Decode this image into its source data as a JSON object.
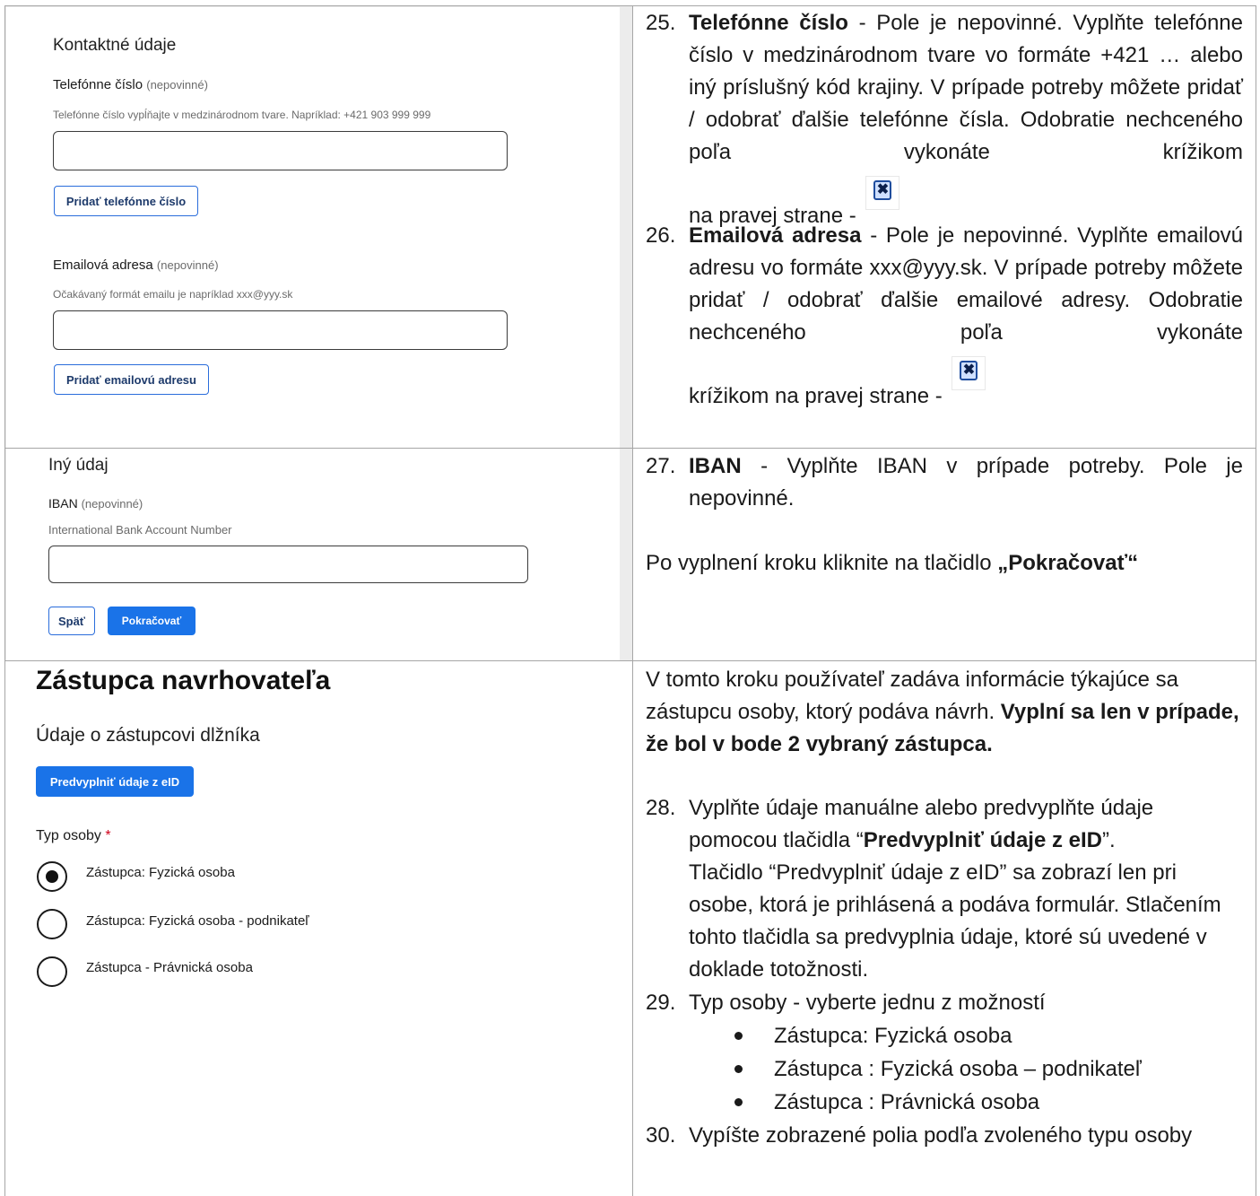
{
  "row1": {
    "form": {
      "section_title": "Kontaktné údaje",
      "phone_label": "Telefónne číslo",
      "phone_optional": "(nepovinné)",
      "phone_hint": "Telefónne číslo vypĺňajte v medzinárodnom tvare. Napríklad: +421 903 999 999",
      "phone_value": "",
      "add_phone_button": "Pridať telefónne číslo",
      "email_label": "Emailová adresa",
      "email_optional": "(nepovinné)",
      "email_hint": "Očakávaný formát emailu je napríklad xxx@yyy.sk",
      "email_value": "",
      "add_email_button": "Pridať emailovú adresu"
    },
    "text": {
      "item25_num": "25.",
      "item25_term": "Telefónne číslo",
      "item25_body": "- Pole je nepovinné. Vyplňte telefónne číslo v medzinárodnom tvare vo formáte +421 … alebo iný príslušný kód krajiny. V prípade potreby môžete pridať / odobrať ďalšie telefónne čísla. Odobratie nechceného poľa vykonáte krížikom",
      "item25_tail": "na pravej strane -",
      "item26_num": "26.",
      "item26_term": "Emailová adresa",
      "item26_body": "- Pole je nepovinné. Vyplňte emailovú adresu vo formáte xxx@yyy.sk. V prípade potreby môžete pridať / odobrať ďalšie emailové adresy. Odobratie nechceného poľa vykonáte",
      "item26_tail": "krížikom na pravej strane -",
      "close_icon_glyph": "✖"
    }
  },
  "row2": {
    "form": {
      "section_title": "Iný údaj",
      "iban_label": "IBAN",
      "iban_optional": "(nepovinné)",
      "iban_hint": "International Bank Account Number",
      "iban_value": "",
      "back_button": "Späť",
      "continue_button": "Pokračovať"
    },
    "text": {
      "item27_num": "27.",
      "item27_term": "IBAN",
      "item27_body": "- Vyplňte IBAN v prípade potreby. Pole je nepovinné.",
      "after_text": "Po vyplnení kroku kliknite na tlačidlo",
      "after_button": "„Pokračovať“"
    }
  },
  "row3": {
    "form": {
      "heading": "Zástupca navrhovateľa",
      "section_title": "Údaje o zástupcovi dlžníka",
      "eid_button": "Predvyplniť údaje z eID",
      "person_type_label": "Typ osoby",
      "required_mark": "*",
      "options": [
        {
          "label": "Zástupca: Fyzická osoba",
          "selected": true
        },
        {
          "label": "Zástupca: Fyzická osoba - podnikateľ",
          "selected": false
        },
        {
          "label": "Zástupca - Právnická osoba",
          "selected": false
        }
      ]
    },
    "text": {
      "intro": "V tomto kroku používateľ zadáva informácie týkajúce sa zástupcu osoby, ktorý podáva návrh.",
      "intro_bold": "Vyplní sa len v prípade, že bol v bode 2 vybraný zástupca.",
      "item28_num": "28.",
      "item28_a": "Vyplňte údaje manuálne alebo predvyplňte údaje pomocou tlačidla “",
      "item28_bold": "Predvyplniť údaje z eID",
      "item28_b": "”.",
      "item28_c": "Tlačidlo “Predvyplniť údaje z eID” sa zobrazí len pri osobe, ktorá je prihlásená a podáva formulár. Stlačením tohto tlačidla sa predvyplnia údaje, ktoré sú uvedené v doklade totožnosti.",
      "item29_num": "29.",
      "item29_text": "Typ osoby - vyberte jednu z možností",
      "bullets": [
        "Zástupca: Fyzická osoba",
        "Zástupca : Fyzická osoba – podnikateľ",
        "Zástupca : Právnická osoba"
      ],
      "item30_num": "30.",
      "item30_text": "Vypíšte zobrazené polia podľa zvoleného typu osoby"
    }
  }
}
